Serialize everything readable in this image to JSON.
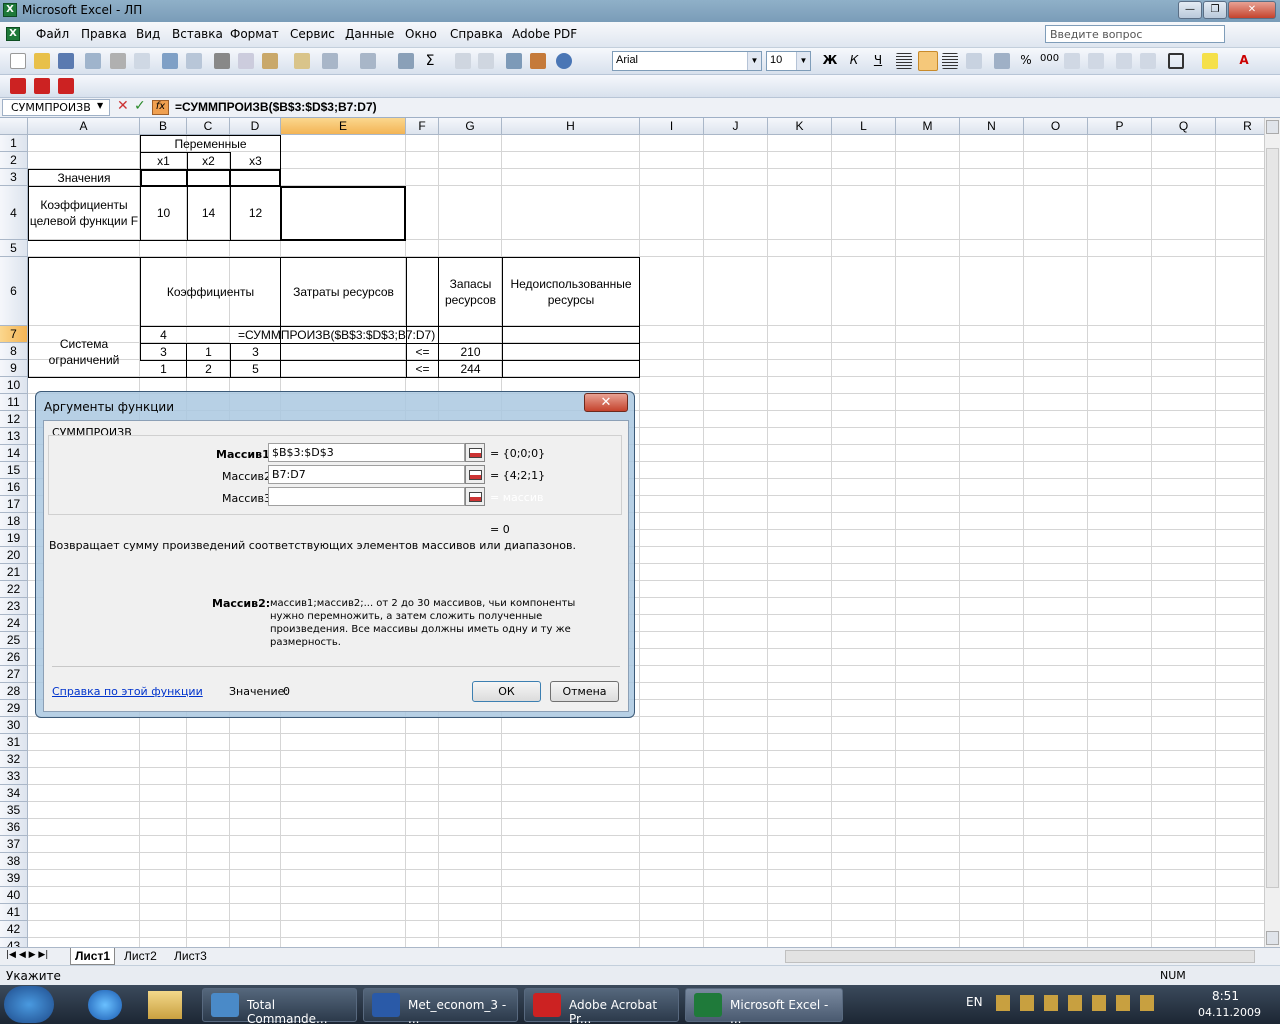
{
  "window": {
    "title": "Microsoft Excel - ЛП",
    "min": "—",
    "max": "❐",
    "close": "✕"
  },
  "menu": {
    "items": [
      "Файл",
      "Правка",
      "Вид",
      "Вставка",
      "Формат",
      "Сервис",
      "Данные",
      "Окно",
      "Справка",
      "Adobe PDF"
    ],
    "help_placeholder": "Введите вопрос"
  },
  "toolbar": {
    "font": "Arial",
    "size": "10",
    "bold": "Ж",
    "italic": "К",
    "underline": "Ч",
    "percent": "%",
    "thousands": "000"
  },
  "formula_bar": {
    "name": "СУММПРОИЗВ",
    "formula": "=СУММПРОИЗВ($B$3:$D$3;B7:D7)",
    "cancel": "✕",
    "enter": "✓",
    "fx": "fx"
  },
  "columns": [
    "A",
    "B",
    "C",
    "D",
    "E",
    "F",
    "G",
    "H",
    "I",
    "J",
    "K",
    "L",
    "M",
    "N",
    "O",
    "P",
    "Q",
    "R"
  ],
  "rows": [
    "1",
    "2",
    "3",
    "4",
    "5",
    "6",
    "7",
    "8",
    "9",
    "10",
    "11",
    "12",
    "13",
    "14",
    "15",
    "16",
    "17",
    "18",
    "19",
    "20",
    "21",
    "22",
    "23",
    "24",
    "25",
    "26",
    "27",
    "28",
    "29",
    "30",
    "31",
    "32",
    "33",
    "34",
    "35",
    "36",
    "37",
    "38",
    "39",
    "40",
    "41",
    "42",
    "43"
  ],
  "cells": {
    "b1": "Переменные",
    "b2": "x1",
    "c2": "x2",
    "d2": "x3",
    "a3": "Значения",
    "a4": "Коэффициенты целевой функции F",
    "b4": "10",
    "c4": "14",
    "d4": "12",
    "b6": "Коэффициенты",
    "e6": "Затраты ресурсов",
    "g6": "Запасы ресурсов",
    "h6": "Недоиспользованные ресурсы",
    "a7": "Система ограничений",
    "b7": "4",
    "e7": "=СУММПРОИЗВ($B$3:$D$3;B7:D7)",
    "b8": "3",
    "c8": "1",
    "d8": "3",
    "f8": "<=",
    "g8": "210",
    "b9": "1",
    "c9": "2",
    "d9": "5",
    "f9": "<=",
    "g9": "244"
  },
  "sheets": [
    "Лист1",
    "Лист2",
    "Лист3"
  ],
  "status": {
    "left": "Укажите",
    "num": "NUM"
  },
  "dialog": {
    "title": "Аргументы функции",
    "func": "СУММПРОИЗВ",
    "args": [
      {
        "label": "Массив1",
        "value": "$B$3:$D$3",
        "result": "= {0;0;0}"
      },
      {
        "label": "Массив2",
        "value": "B7:D7",
        "result": "= {4;2;1}"
      },
      {
        "label": "Массив3",
        "value": "",
        "result": "= массив"
      }
    ],
    "total": "= 0",
    "description": "Возвращает сумму произведений соответствующих элементов массивов или диапазонов.",
    "arg_name": "Массив2:",
    "arg_help": "массив1;массив2;... от 2 до 30 массивов, чьи компоненты нужно перемножить, а затем сложить полученные произведения. Все массивы должны иметь одну и ту же размерность.",
    "help_link": "Справка по этой функции",
    "value_label": "Значение:",
    "value": "0",
    "ok": "ОК",
    "cancel": "Отмена"
  },
  "taskbar": {
    "items": [
      "Total Commande...",
      "Met_econom_3 - ...",
      "Adobe Acrobat Pr...",
      "Microsoft Excel - ..."
    ],
    "lang": "EN",
    "time": "8:51",
    "date": "04.11.2009"
  }
}
